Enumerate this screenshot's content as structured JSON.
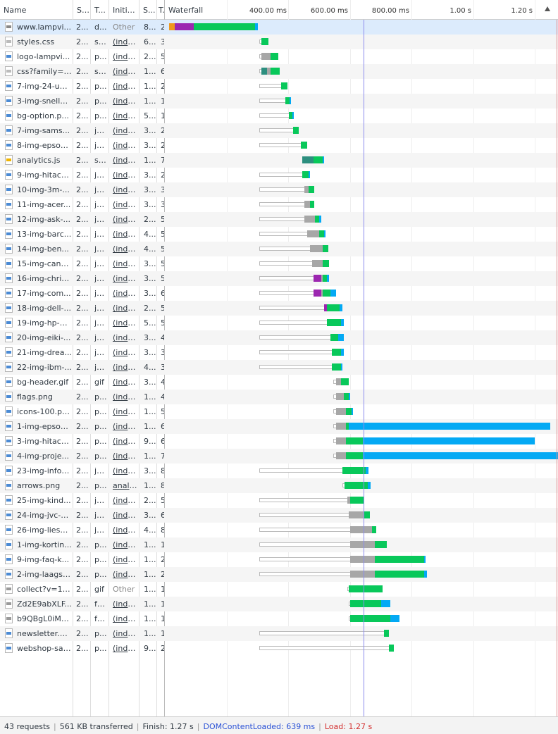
{
  "header": {
    "columns": [
      "Name",
      "St...",
      "T...",
      "Initia...",
      "S...",
      "T...",
      "Waterfall"
    ],
    "ticks": [
      "400.00 ms",
      "600.00 ms",
      "800.00 ms",
      "1.00 s",
      "1.20 s"
    ]
  },
  "rows": [
    {
      "name": "www.lampvi...",
      "status": "2...",
      "type": "d...",
      "initiator": "Other",
      "size": "8...",
      "time": "2",
      "icon": "html-icon"
    },
    {
      "name": "styles.css",
      "status": "2...",
      "type": "st...",
      "initiator": "(inde...",
      "size": "6...",
      "time": "3",
      "icon": "css-icon"
    },
    {
      "name": "logo-lampvi...",
      "status": "2...",
      "type": "p...",
      "initiator": "(inde...",
      "size": "2...",
      "time": "5",
      "icon": "image-icon"
    },
    {
      "name": "css?family=R...",
      "status": "2...",
      "type": "st...",
      "initiator": "(inde...",
      "size": "1...",
      "time": "6",
      "icon": "css-icon"
    },
    {
      "name": "7-img-24-uu...",
      "status": "2...",
      "type": "p...",
      "initiator": "(inde...",
      "size": "1...",
      "time": "2",
      "icon": "image-icon"
    },
    {
      "name": "3-img-snelle...",
      "status": "2...",
      "type": "p...",
      "initiator": "(inde...",
      "size": "1...",
      "time": "1",
      "icon": "image-icon"
    },
    {
      "name": "bg-option.p...",
      "status": "2...",
      "type": "p...",
      "initiator": "(inde...",
      "size": "5...",
      "time": "1",
      "icon": "image-icon"
    },
    {
      "name": "7-img-sams...",
      "status": "2...",
      "type": "jp...",
      "initiator": "(inde...",
      "size": "3...",
      "time": "2",
      "icon": "image-icon"
    },
    {
      "name": "8-img-epson...",
      "status": "2...",
      "type": "jp...",
      "initiator": "(inde...",
      "size": "3...",
      "time": "2",
      "icon": "image-icon"
    },
    {
      "name": "analytics.js",
      "status": "2...",
      "type": "sc...",
      "initiator": "(inde...",
      "size": "1...",
      "time": "7",
      "icon": "script-icon"
    },
    {
      "name": "9-img-hitach...",
      "status": "2...",
      "type": "jp...",
      "initiator": "(inde...",
      "size": "3...",
      "time": "2",
      "icon": "image-icon"
    },
    {
      "name": "10-img-3m-...",
      "status": "2...",
      "type": "jp...",
      "initiator": "(inde...",
      "size": "3...",
      "time": "3",
      "icon": "image-icon"
    },
    {
      "name": "11-img-acer...",
      "status": "2...",
      "type": "jp...",
      "initiator": "(inde...",
      "size": "3...",
      "time": "3",
      "icon": "image-icon"
    },
    {
      "name": "12-img-ask-...",
      "status": "2...",
      "type": "jp...",
      "initiator": "(inde...",
      "size": "2...",
      "time": "5",
      "icon": "image-icon"
    },
    {
      "name": "13-img-barc...",
      "status": "2...",
      "type": "jp...",
      "initiator": "(inde...",
      "size": "4...",
      "time": "5",
      "icon": "image-icon"
    },
    {
      "name": "14-img-ben...",
      "status": "2...",
      "type": "jp...",
      "initiator": "(inde...",
      "size": "4...",
      "time": "5",
      "icon": "image-icon"
    },
    {
      "name": "15-img-cano...",
      "status": "2...",
      "type": "jp...",
      "initiator": "(inde...",
      "size": "3...",
      "time": "5",
      "icon": "image-icon"
    },
    {
      "name": "16-img-chris...",
      "status": "2...",
      "type": "jp...",
      "initiator": "(inde...",
      "size": "3...",
      "time": "5",
      "icon": "image-icon"
    },
    {
      "name": "17-img-com...",
      "status": "2...",
      "type": "jp...",
      "initiator": "(inde...",
      "size": "3...",
      "time": "6",
      "icon": "image-icon"
    },
    {
      "name": "18-img-dell-...",
      "status": "2...",
      "type": "jp...",
      "initiator": "(inde...",
      "size": "2...",
      "time": "5",
      "icon": "image-icon"
    },
    {
      "name": "19-img-hp-p...",
      "status": "2...",
      "type": "jp...",
      "initiator": "(inde...",
      "size": "5...",
      "time": "5",
      "icon": "image-icon"
    },
    {
      "name": "20-img-eiki-...",
      "status": "2...",
      "type": "jp...",
      "initiator": "(inde...",
      "size": "3...",
      "time": "4",
      "icon": "image-icon"
    },
    {
      "name": "21-img-drea...",
      "status": "2...",
      "type": "jp...",
      "initiator": "(inde...",
      "size": "3...",
      "time": "3",
      "icon": "image-icon"
    },
    {
      "name": "22-img-ibm-...",
      "status": "2...",
      "type": "jp...",
      "initiator": "(inde...",
      "size": "4...",
      "time": "3",
      "icon": "image-icon"
    },
    {
      "name": "bg-header.gif",
      "status": "2...",
      "type": "gif",
      "initiator": "(inde...",
      "size": "3...",
      "time": "4",
      "icon": "image-icon"
    },
    {
      "name": "flags.png",
      "status": "2...",
      "type": "p...",
      "initiator": "(inde...",
      "size": "1...",
      "time": "4",
      "icon": "image-icon"
    },
    {
      "name": "icons-100.pn...",
      "status": "2...",
      "type": "p...",
      "initiator": "(inde...",
      "size": "1...",
      "time": "5",
      "icon": "image-icon"
    },
    {
      "name": "1-img-epson...",
      "status": "2...",
      "type": "p...",
      "initiator": "(inde...",
      "size": "1...",
      "time": "6",
      "icon": "image-icon"
    },
    {
      "name": "3-img-hitach...",
      "status": "2...",
      "type": "p...",
      "initiator": "(inde...",
      "size": "9...",
      "time": "6",
      "icon": "image-icon"
    },
    {
      "name": "4-img-proje...",
      "status": "2...",
      "type": "p...",
      "initiator": "(inde...",
      "size": "1...",
      "time": "7",
      "icon": "image-icon"
    },
    {
      "name": "23-img-infoc...",
      "status": "2...",
      "type": "jp...",
      "initiator": "(inde...",
      "size": "3...",
      "time": "8",
      "icon": "image-icon"
    },
    {
      "name": "arrows.png",
      "status": "2...",
      "type": "p...",
      "initiator": "analy...",
      "size": "1...",
      "time": "8",
      "icon": "image-icon"
    },
    {
      "name": "25-img-kind...",
      "status": "2...",
      "type": "jp...",
      "initiator": "(inde...",
      "size": "2...",
      "time": "5",
      "icon": "image-icon"
    },
    {
      "name": "24-img-jvc-p...",
      "status": "2...",
      "type": "jp...",
      "initiator": "(inde...",
      "size": "3...",
      "time": "6",
      "icon": "image-icon"
    },
    {
      "name": "26-img-liese...",
      "status": "2...",
      "type": "jp...",
      "initiator": "(inde...",
      "size": "4...",
      "time": "8",
      "icon": "image-icon"
    },
    {
      "name": "1-img-kortin...",
      "status": "2...",
      "type": "p...",
      "initiator": "(inde...",
      "size": "1...",
      "time": "1",
      "icon": "image-icon"
    },
    {
      "name": "9-img-faq-k...",
      "status": "2...",
      "type": "p...",
      "initiator": "(inde...",
      "size": "1...",
      "time": "2",
      "icon": "image-icon"
    },
    {
      "name": "2-img-laagst...",
      "status": "2...",
      "type": "p...",
      "initiator": "(inde...",
      "size": "1...",
      "time": "2",
      "icon": "image-icon"
    },
    {
      "name": "collect?v=1&...",
      "status": "2...",
      "type": "gif",
      "initiator": "Other",
      "size": "1...",
      "time": "1",
      "icon": "document-icon"
    },
    {
      "name": "Zd2E9abXLF...",
      "status": "2...",
      "type": "fo...",
      "initiator": "(inde...",
      "size": "1...",
      "time": "1",
      "icon": "font-icon"
    },
    {
      "name": "b9QBgL0iMZ...",
      "status": "2...",
      "type": "fo...",
      "initiator": "(inde...",
      "size": "1...",
      "time": "1",
      "icon": "font-icon"
    },
    {
      "name": "newsletter.p...",
      "status": "2...",
      "type": "p...",
      "initiator": "(inde...",
      "size": "1...",
      "time": "1",
      "icon": "image-icon"
    },
    {
      "name": "webshop-saf...",
      "status": "2...",
      "type": "p...",
      "initiator": "(inde...",
      "size": "9...",
      "time": "2",
      "icon": "image-icon"
    }
  ],
  "timing_ms": [
    {
      "start": 10,
      "queue": 20,
      "stall": 60,
      "wait": 0,
      "ttfb": 200,
      "download": 10
    },
    {
      "queue_from": 305,
      "start": 310,
      "wait": 0,
      "ttfb": 25,
      "download": 0
    },
    {
      "queue_from": 305,
      "start": 310,
      "wait": 30,
      "ttfb": 25,
      "download": 0
    },
    {
      "queue_from": 305,
      "start": 310,
      "dns": 20,
      "wait": 10,
      "ttfb": 30,
      "download": 0
    },
    {
      "queue_from": 305,
      "start": 375,
      "wait": 0,
      "ttfb": 20,
      "download": 0
    },
    {
      "queue_from": 305,
      "start": 390,
      "wait": 0,
      "ttfb": 12,
      "download": 5
    },
    {
      "queue_from": 305,
      "start": 400,
      "wait": 0,
      "ttfb": 12,
      "download": 5
    },
    {
      "queue_from": 305,
      "start": 415,
      "wait": 0,
      "ttfb": 18,
      "download": 0
    },
    {
      "queue_from": 305,
      "start": 440,
      "wait": 0,
      "ttfb": 20,
      "download": 0
    },
    {
      "start": 445,
      "dns": 35,
      "wait": 0,
      "ttfb": 30,
      "download": 5
    },
    {
      "queue_from": 305,
      "start": 445,
      "wait": 0,
      "ttfb": 20,
      "download": 5
    },
    {
      "queue_from": 305,
      "start": 450,
      "wait": 15,
      "ttfb": 18,
      "download": 0
    },
    {
      "queue_from": 305,
      "start": 450,
      "wait": 20,
      "ttfb": 12,
      "download": 0
    },
    {
      "queue_from": 305,
      "start": 450,
      "wait": 35,
      "ttfb": 15,
      "download": 5
    },
    {
      "queue_from": 305,
      "start": 460,
      "wait": 40,
      "ttfb": 15,
      "download": 5
    },
    {
      "queue_from": 305,
      "start": 470,
      "wait": 40,
      "ttfb": 18,
      "download": 0
    },
    {
      "queue_from": 305,
      "start": 475,
      "wait": 35,
      "ttfb": 20,
      "download": 0
    },
    {
      "queue_from": 305,
      "start": 480,
      "stall": 25,
      "wait": 5,
      "ttfb": 15,
      "download": 5
    },
    {
      "queue_from": 305,
      "start": 480,
      "stall": 25,
      "wait": 5,
      "ttfb": 25,
      "download": 20
    },
    {
      "queue_from": 305,
      "start": 515,
      "stall": 10,
      "wait": 0,
      "ttfb": 40,
      "download": 10
    },
    {
      "queue_from": 305,
      "start": 525,
      "wait": 0,
      "ttfb": 45,
      "download": 10
    },
    {
      "queue_from": 305,
      "start": 535,
      "wait": 0,
      "ttfb": 25,
      "download": 20
    },
    {
      "queue_from": 305,
      "start": 540,
      "wait": 0,
      "ttfb": 30,
      "download": 10
    },
    {
      "queue_from": 305,
      "start": 540,
      "wait": 0,
      "ttfb": 30,
      "download": 5
    },
    {
      "queue_from": 545,
      "start": 555,
      "wait": 15,
      "ttfb": 25,
      "download": 0
    },
    {
      "queue_from": 545,
      "start": 555,
      "wait": 25,
      "ttfb": 15,
      "download": 5
    },
    {
      "queue_from": 545,
      "start": 555,
      "wait": 30,
      "ttfb": 20,
      "download": 5
    },
    {
      "queue_from": 545,
      "start": 555,
      "wait": 30,
      "ttfb": 10,
      "download": 655
    },
    {
      "queue_from": 545,
      "start": 555,
      "wait": 30,
      "ttfb": 55,
      "download": 560
    },
    {
      "queue_from": 545,
      "start": 555,
      "wait": 30,
      "ttfb": 55,
      "download": 665
    },
    {
      "queue_from": 305,
      "start": 575,
      "wait": 0,
      "ttfb": 75,
      "download": 10
    },
    {
      "queue_from": 575,
      "start": 582,
      "wait": 0,
      "ttfb": 75,
      "download": 10
    },
    {
      "queue_from": 305,
      "start": 590,
      "wait": 10,
      "ttfb": 45,
      "download": 0
    },
    {
      "queue_from": 305,
      "start": 595,
      "wait": 50,
      "ttfb": 20,
      "download": 0
    },
    {
      "queue_from": 305,
      "start": 600,
      "wait": 70,
      "ttfb": 15,
      "download": 0
    },
    {
      "queue_from": 305,
      "start": 600,
      "wait": 80,
      "ttfb": 40,
      "download": 0
    },
    {
      "queue_from": 305,
      "start": 600,
      "wait": 80,
      "ttfb": 160,
      "download": 5
    },
    {
      "queue_from": 305,
      "start": 600,
      "wait": 80,
      "ttfb": 160,
      "download": 10
    },
    {
      "queue_from": 590,
      "start": 595,
      "wait": 0,
      "ttfb": 110,
      "download": 0
    },
    {
      "queue_from": 595,
      "start": 600,
      "wait": 0,
      "ttfb": 100,
      "download": 30
    },
    {
      "queue_from": 595,
      "start": 600,
      "wait": 0,
      "ttfb": 130,
      "download": 30
    },
    {
      "queue_from": 305,
      "start": 710,
      "wait": 0,
      "ttfb": 15,
      "download": 0
    },
    {
      "queue_from": 305,
      "start": 725,
      "wait": 0,
      "ttfb": 18,
      "download": 0
    }
  ],
  "timeline": {
    "dom_content_loaded_ms": 639,
    "load_ms": 1270
  },
  "colors": {
    "queue": "#f0981e",
    "dns": "#2d8f7f",
    "stall": "#9c27b0",
    "wait": "#a7a7a7",
    "ttfb": "#08c85a",
    "download": "#03a9f4",
    "dcl": "#8d8ded",
    "load": "#e09090"
  },
  "status": {
    "requests": "43 requests",
    "transferred": "561 KB transferred",
    "finish": "Finish: 1.27 s",
    "dcl": "DOMContentLoaded: 639 ms",
    "load": "Load: 1.27 s"
  }
}
